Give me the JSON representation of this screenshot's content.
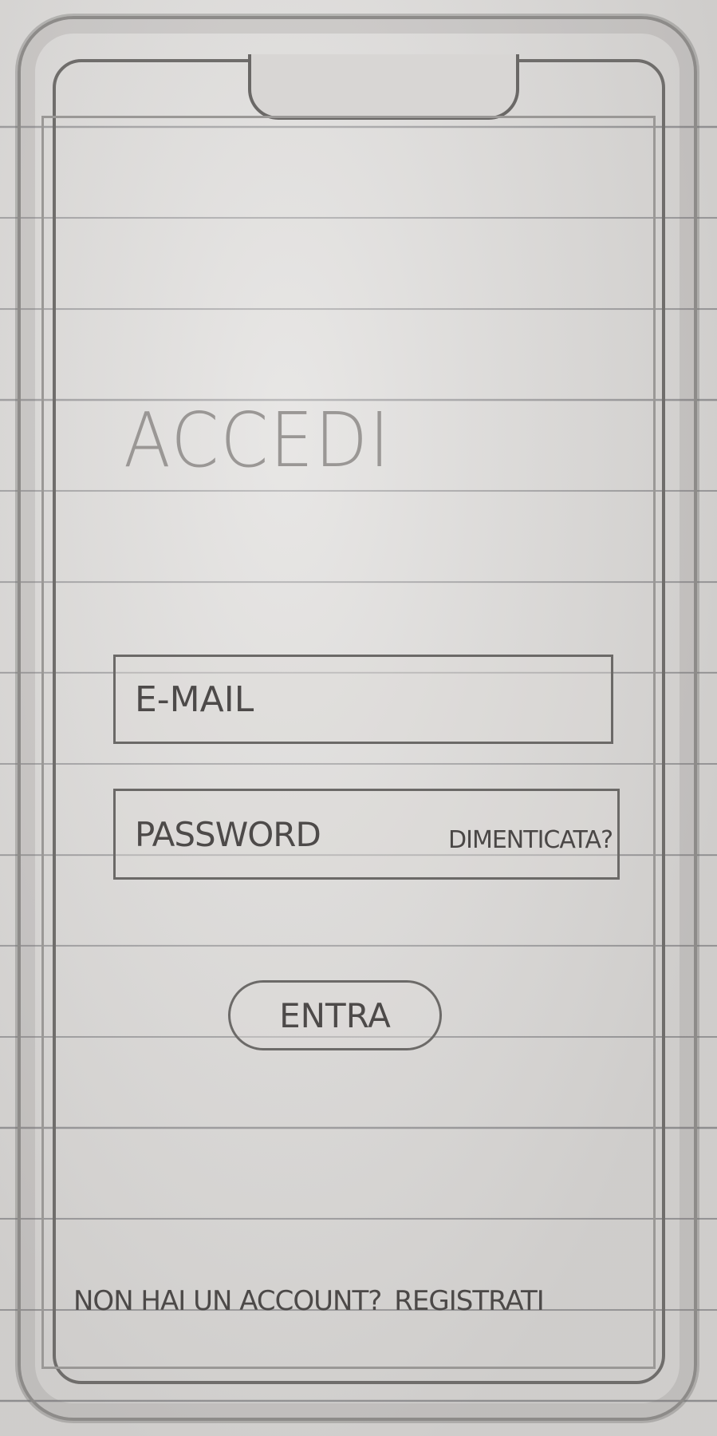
{
  "login": {
    "title": "ACCEDI",
    "email_placeholder": "E-MAIL",
    "password_placeholder": "PASSWORD",
    "forgot_label": "DIMENTICATA?",
    "submit_label": "ENTRA"
  },
  "signup": {
    "prompt": "NON HAI UN ACCOUNT?",
    "link_label": "REGISTRATI"
  }
}
